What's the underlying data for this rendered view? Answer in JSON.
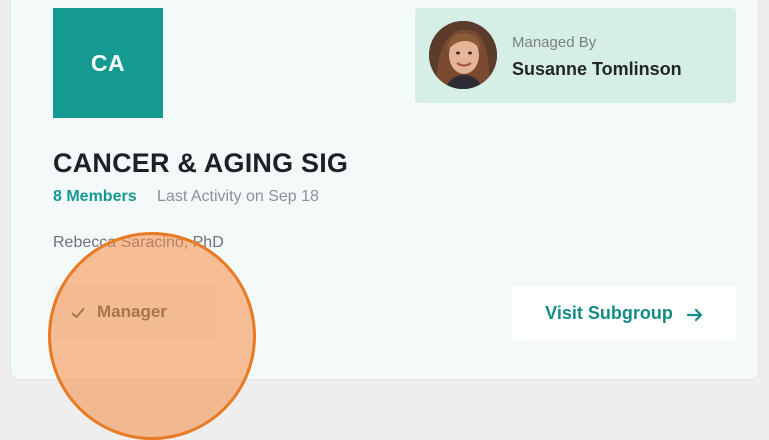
{
  "group": {
    "initials": "CA",
    "name": "CANCER & AGING SIG",
    "members": "8 Members",
    "last_activity": "Last Activity on Sep 18",
    "author": "Rebecca Saracino, PhD"
  },
  "manager": {
    "label": "Managed By",
    "name": "Susanne Tomlinson"
  },
  "role_badge": {
    "label": "Manager",
    "icon": "check-icon"
  },
  "actions": {
    "visit_label": "Visit Subgroup",
    "visit_icon": "arrow-right-icon"
  },
  "colors": {
    "brand_teal": "#159a92",
    "managed_bg": "#d6efe6",
    "click_highlight": "#e87a24"
  }
}
